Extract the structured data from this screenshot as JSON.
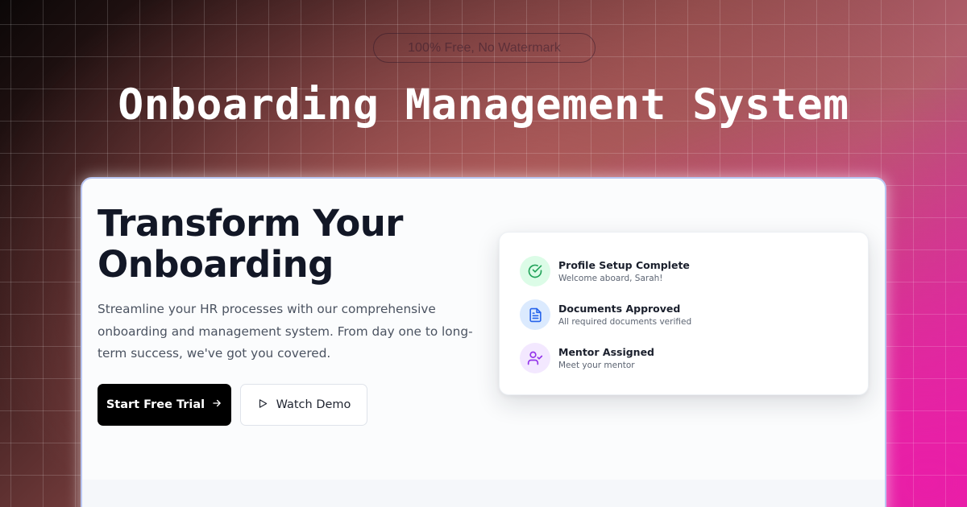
{
  "badge": {
    "label": "100% Free, No Watermark"
  },
  "headline": "Onboarding Management System",
  "hero": {
    "title_line1": "Transform Your",
    "title_line2": "Onboarding",
    "description": "Streamline your HR processes with our comprehensive onboarding and management system. From day one to long-term success, we've got you covered.",
    "primary_button": {
      "label": "Start Free Trial",
      "icon": "arrow-right-icon"
    },
    "secondary_button": {
      "label": "Watch Demo",
      "icon": "play-icon"
    }
  },
  "status_panel": {
    "items": [
      {
        "title": "Profile Setup Complete",
        "subtitle": "Welcome aboard, Sarah!",
        "icon": "check-circle-icon",
        "icon_color": "#22a35a",
        "icon_bg": "#dcfce7"
      },
      {
        "title": "Documents Approved",
        "subtitle": "All required documents verified",
        "icon": "document-icon",
        "icon_color": "#2563eb",
        "icon_bg": "#dbeafe"
      },
      {
        "title": "Mentor Assigned",
        "subtitle": "Meet your mentor",
        "icon": "user-check-icon",
        "icon_color": "#9333ea",
        "icon_bg": "#f3e8ff"
      }
    ]
  }
}
